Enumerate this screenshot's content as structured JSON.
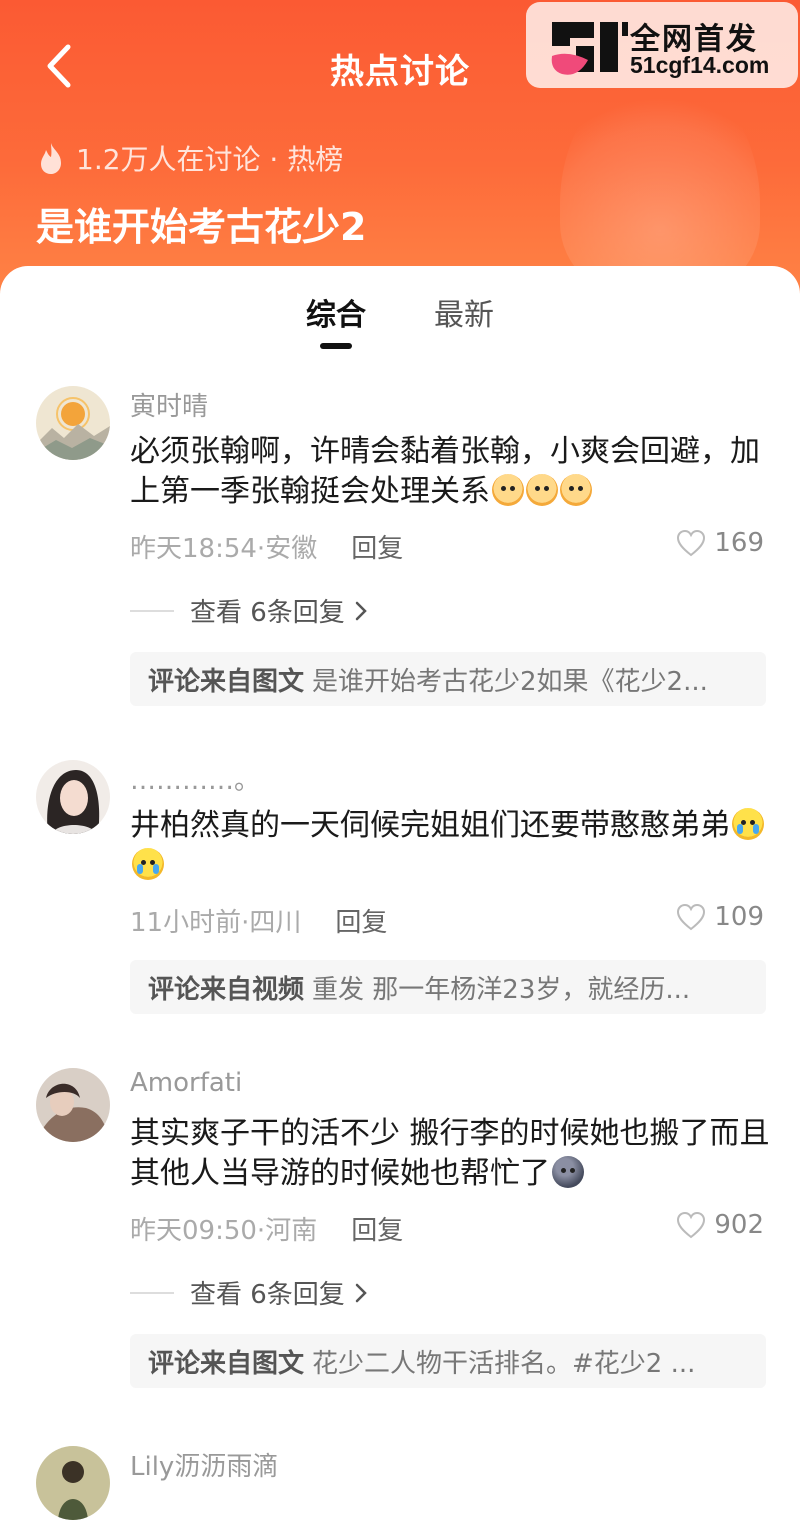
{
  "header": {
    "title": "热点讨论",
    "discussion_count": "1.2万人在讨论 · 热榜",
    "topic": "是谁开始考古花少2",
    "background_color": "#fb5a33"
  },
  "watermark": {
    "line1": "全网首发",
    "line2": "51cgf14.com"
  },
  "tabs": [
    {
      "label": "综合",
      "active": true
    },
    {
      "label": "最新",
      "active": false
    }
  ],
  "comments": [
    {
      "username": "寅时晴",
      "text": "必须张翰啊，许晴会黏着张翰，小爽会回避，加上第一季张翰挺会处理关系",
      "emojis": [
        "cat-emoji",
        "cat-emoji",
        "cat-emoji"
      ],
      "time_location": "昨天18:54·安徽",
      "reply_label": "回复",
      "likes": "169",
      "view_replies": "查看 6条回复",
      "source_label": "评论来自图文",
      "source_text": "是谁开始考古花少2如果《花少2..."
    },
    {
      "username": "…………。",
      "text": "井柏然真的一天伺候完姐姐们还要带憨憨弟弟",
      "emojis": [
        "crying-emoji",
        "crying-emoji"
      ],
      "time_location": "11小时前·四川",
      "reply_label": "回复",
      "likes": "109",
      "source_label": "评论来自视频",
      "source_text": "重发 那一年杨洋23岁，就经历..."
    },
    {
      "username": "Amorfati",
      "text": "其实爽子干的活不少 搬行李的时候她也搬了而且其他人当导游的时候她也帮忙了",
      "emojis": [
        "moon-emoji"
      ],
      "time_location": "昨天09:50·河南",
      "reply_label": "回复",
      "likes": "902",
      "view_replies": "查看 6条回复",
      "source_label": "评论来自图文",
      "source_text": "花少二人物干活排名。#花少2 ..."
    },
    {
      "username": "Lily沥沥雨滴"
    }
  ]
}
